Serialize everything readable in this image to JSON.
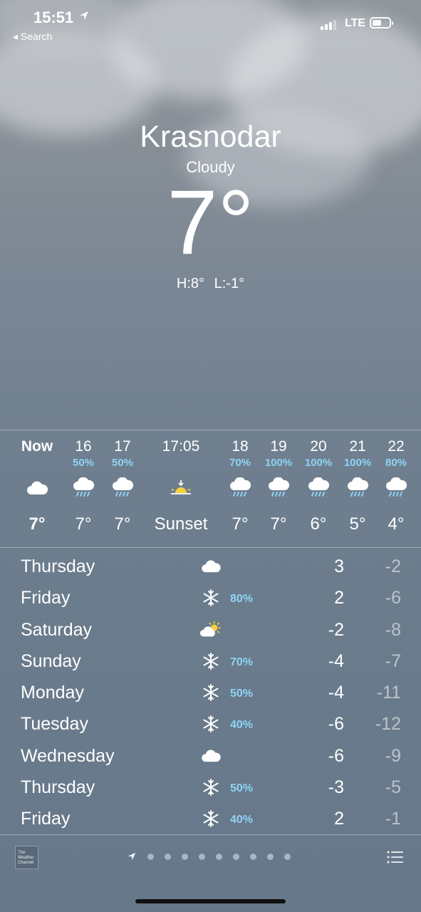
{
  "status": {
    "time": "15:51",
    "back_label": "◂ Search",
    "network": "LTE"
  },
  "header": {
    "city": "Krasnodar",
    "condition": "Cloudy",
    "temperature": "7°",
    "high": "H:8°",
    "low": "L:-1°"
  },
  "hourly": [
    {
      "time": "Now",
      "pop": "",
      "icon": "cloud-icon",
      "temp": "7°"
    },
    {
      "time": "16",
      "pop": "50%",
      "icon": "cloud-rain-icon",
      "temp": "7°"
    },
    {
      "time": "17",
      "pop": "50%",
      "icon": "cloud-rain-icon",
      "temp": "7°"
    },
    {
      "time": "17:05",
      "pop": "",
      "icon": "sunset-icon",
      "temp": "Sunset"
    },
    {
      "time": "18",
      "pop": "70%",
      "icon": "cloud-rain-icon",
      "temp": "7°"
    },
    {
      "time": "19",
      "pop": "100%",
      "icon": "cloud-rain-icon",
      "temp": "7°"
    },
    {
      "time": "20",
      "pop": "100%",
      "icon": "cloud-rain-icon",
      "temp": "6°"
    },
    {
      "time": "21",
      "pop": "100%",
      "icon": "cloud-rain-icon",
      "temp": "5°"
    },
    {
      "time": "22",
      "pop": "80%",
      "icon": "cloud-rain-icon",
      "temp": "4°"
    }
  ],
  "daily": [
    {
      "day": "Thursday",
      "icon": "cloud-icon",
      "pop": "",
      "high": "3",
      "low": "-2"
    },
    {
      "day": "Friday",
      "icon": "snowflake-icon",
      "pop": "80%",
      "high": "2",
      "low": "-6"
    },
    {
      "day": "Saturday",
      "icon": "partly-cloudy-icon",
      "pop": "",
      "high": "-2",
      "low": "-8"
    },
    {
      "day": "Sunday",
      "icon": "snowflake-icon",
      "pop": "70%",
      "high": "-4",
      "low": "-7"
    },
    {
      "day": "Monday",
      "icon": "snowflake-icon",
      "pop": "50%",
      "high": "-4",
      "low": "-11"
    },
    {
      "day": "Tuesday",
      "icon": "snowflake-icon",
      "pop": "40%",
      "high": "-6",
      "low": "-12"
    },
    {
      "day": "Wednesday",
      "icon": "cloud-icon",
      "pop": "",
      "high": "-6",
      "low": "-9"
    },
    {
      "day": "Thursday",
      "icon": "snowflake-icon",
      "pop": "50%",
      "high": "-3",
      "low": "-5"
    },
    {
      "day": "Friday",
      "icon": "snowflake-icon",
      "pop": "40%",
      "high": "2",
      "low": "-1"
    }
  ],
  "footer": {
    "provider_logo_text": "The Weather Channel",
    "page_count": 9,
    "current_page": "location"
  },
  "colors": {
    "pop_blue": "#8fd3f5",
    "sun_yellow": "#f7d13c"
  }
}
